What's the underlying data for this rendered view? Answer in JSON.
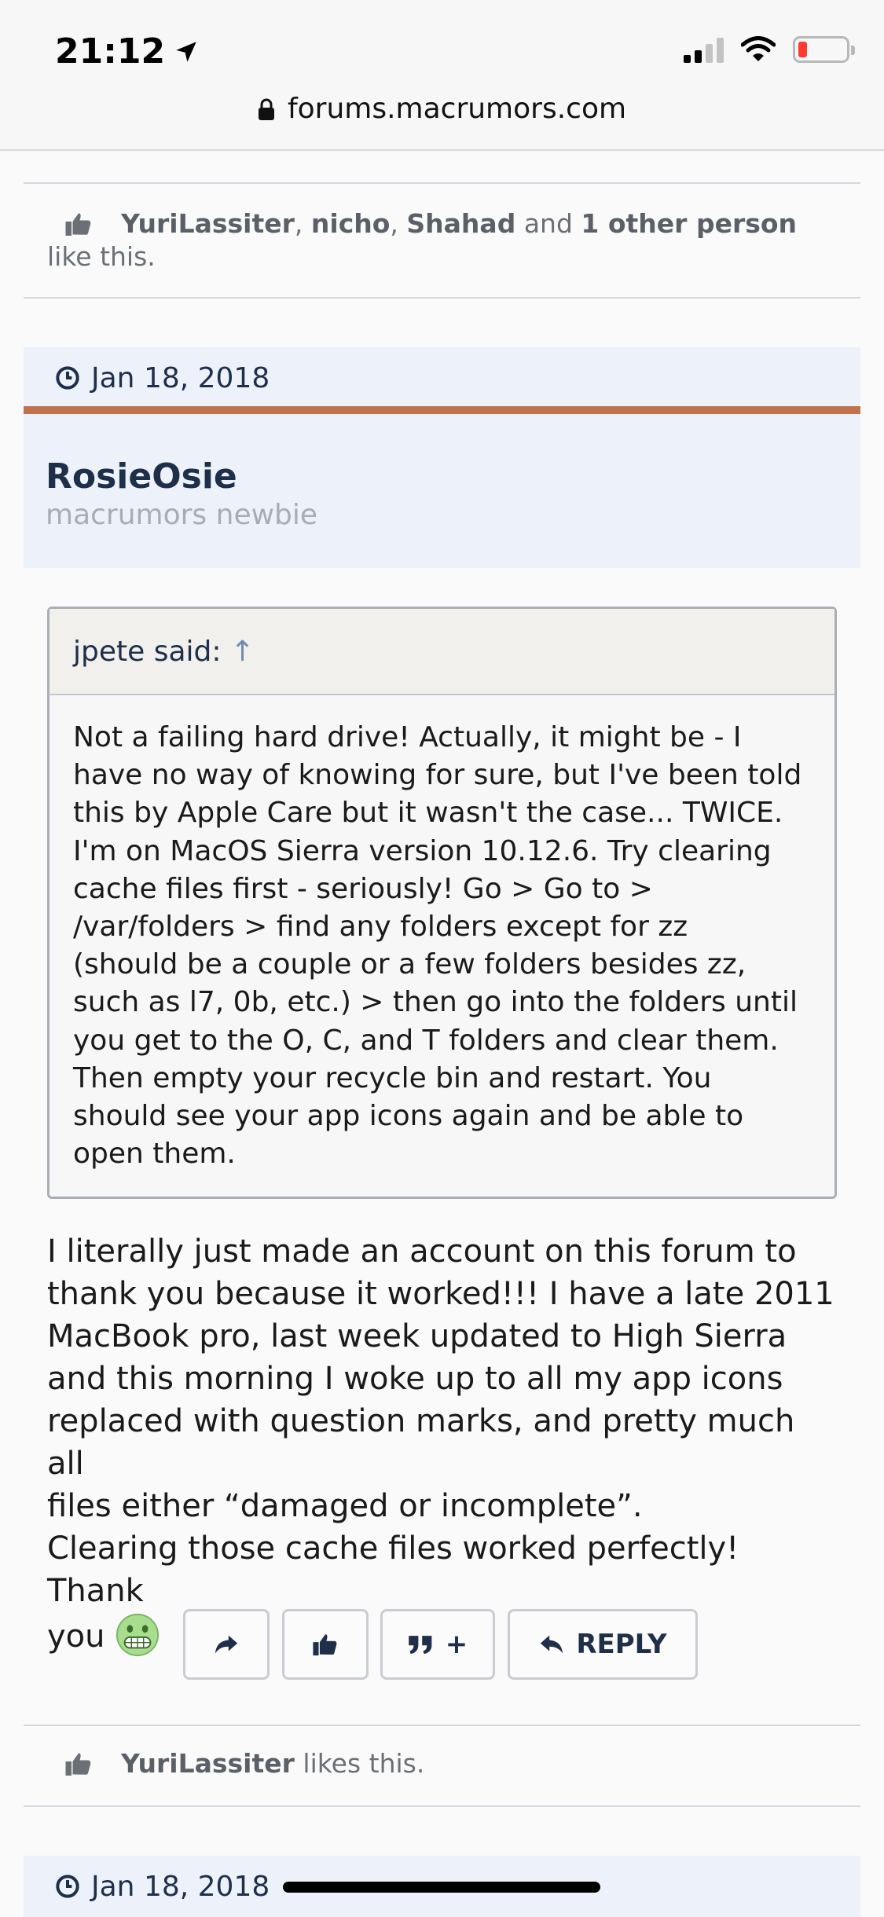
{
  "status_bar": {
    "time": "21:12",
    "location_icon": "location-arrow-icon",
    "icons": [
      "cellular-signal-icon",
      "wifi-icon",
      "battery-low-icon"
    ]
  },
  "browser": {
    "url": "forums.macrumors.com",
    "lock_icon": "lock-icon"
  },
  "likes_top": {
    "names": [
      "YuriLassiter",
      "nicho",
      "Shahad"
    ],
    "sep1": ", ",
    "sep2": ", ",
    "and_text": " and ",
    "other": "1 other person",
    "suffix": "like this."
  },
  "post": {
    "date": "Jan 18, 2018",
    "author": "RosieOsie",
    "author_title": "macrumors newbie",
    "quote": {
      "attribution": "jpete said:",
      "arrow": "↑",
      "lines": [
        "Not a failing hard drive! Actually, it might be - I",
        "have no way of knowing for sure, but I've been told",
        "this by Apple Care but it wasn't the case... TWICE.",
        "I'm on MacOS Sierra version 10.12.6. Try clearing",
        "cache files first - seriously! Go > Go to >",
        "/var/folders > find any folders except for zz",
        "(should be a couple or a few folders besides zz,",
        "such as l7, 0b, etc.) > then go into the folders until",
        "you get to the O, C, and T folders and clear them.",
        "Then empty your recycle bin and restart. You",
        "should see your app icons again and be able to",
        "open them."
      ]
    },
    "body_lines": [
      "I literally just made an account on this forum to",
      "thank you because it worked!!! I have a late 2011",
      "MacBook pro, last week updated to High Sierra",
      "and this morning I woke up to all my app icons",
      "replaced with question marks, and pretty much all",
      "files either “damaged or incomplete”.",
      "Clearing those cache files worked perfectly! Thank",
      "you"
    ],
    "actions": {
      "share_icon": "share-icon",
      "like_icon": "thumbs-up-icon",
      "quote_icon": "quote-icon",
      "quote_plus": "+",
      "reply_icon": "reply-icon",
      "reply_label": "REPLY"
    },
    "likes": {
      "name": "YuriLassiter",
      "suffix": " likes this."
    }
  },
  "next_post": {
    "date": "Jan 18, 2018"
  },
  "colors": {
    "accent_rule": "#c0724e",
    "header_bg": "#edf2fa",
    "name_color": "#1f2f4a",
    "battery_low": "#ff3b30"
  }
}
